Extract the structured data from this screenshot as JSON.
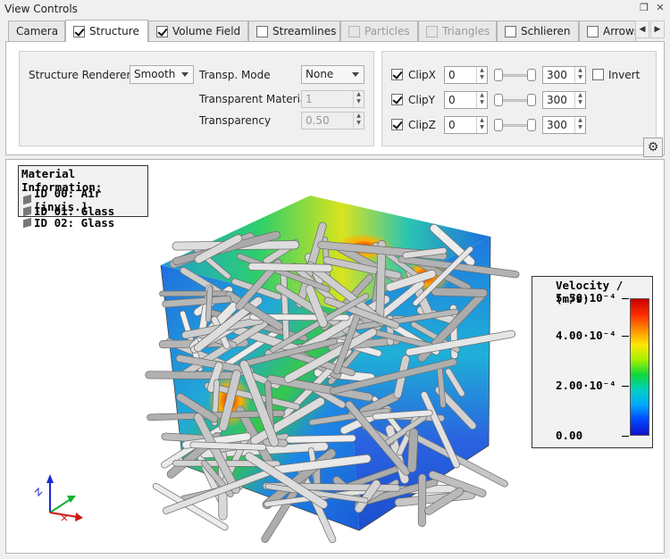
{
  "window": {
    "title": "View Controls"
  },
  "tabs": [
    {
      "label": "Camera",
      "has_checkbox": false,
      "checked": false,
      "disabled": false,
      "active": false
    },
    {
      "label": "Structure",
      "has_checkbox": true,
      "checked": true,
      "disabled": false,
      "active": true
    },
    {
      "label": "Volume Field",
      "has_checkbox": true,
      "checked": true,
      "disabled": false,
      "active": false
    },
    {
      "label": "Streamlines",
      "has_checkbox": true,
      "checked": false,
      "disabled": false,
      "active": false
    },
    {
      "label": "Particles",
      "has_checkbox": true,
      "checked": false,
      "disabled": true,
      "active": false
    },
    {
      "label": "Triangles",
      "has_checkbox": true,
      "checked": false,
      "disabled": true,
      "active": false
    },
    {
      "label": "Schlieren",
      "has_checkbox": true,
      "checked": false,
      "disabled": false,
      "active": false
    },
    {
      "label": "Arrows",
      "has_checkbox": true,
      "checked": false,
      "disabled": false,
      "active": false
    }
  ],
  "structure": {
    "renderer_label": "Structure Renderer",
    "renderer_value": "Smooth",
    "transp_mode_label": "Transp. Mode",
    "transp_mode_value": "None",
    "transp_material_label": "Transparent Material",
    "transp_material_value": "1",
    "transparency_label": "Transparency",
    "transparency_value": "0.50"
  },
  "clip": {
    "rows": [
      {
        "label": "ClipX",
        "checked": true,
        "min": "0",
        "max": "300"
      },
      {
        "label": "ClipY",
        "checked": true,
        "min": "0",
        "max": "300"
      },
      {
        "label": "ClipZ",
        "checked": true,
        "min": "0",
        "max": "300"
      }
    ],
    "invert_label": "Invert",
    "invert_checked": false
  },
  "material_info": {
    "title": "Material Information:",
    "items": [
      "ID 00: Air [invis.]",
      "ID 01: Glass",
      "ID 02: Glass"
    ]
  },
  "legend": {
    "title": "Velocity / (m/s)",
    "ticks": [
      {
        "label": "5.50·10⁻⁴",
        "frac": 1.0
      },
      {
        "label": "4.00·10⁻⁴",
        "frac": 0.727
      },
      {
        "label": "2.00·10⁻⁴",
        "frac": 0.364
      },
      {
        "label": "0.00",
        "frac": 0.0
      }
    ]
  },
  "colors": {
    "accent": "#0078d7",
    "fiber": "#d0d0d0",
    "field_blue": "#1f6fe0",
    "field_red": "#d81e00"
  }
}
